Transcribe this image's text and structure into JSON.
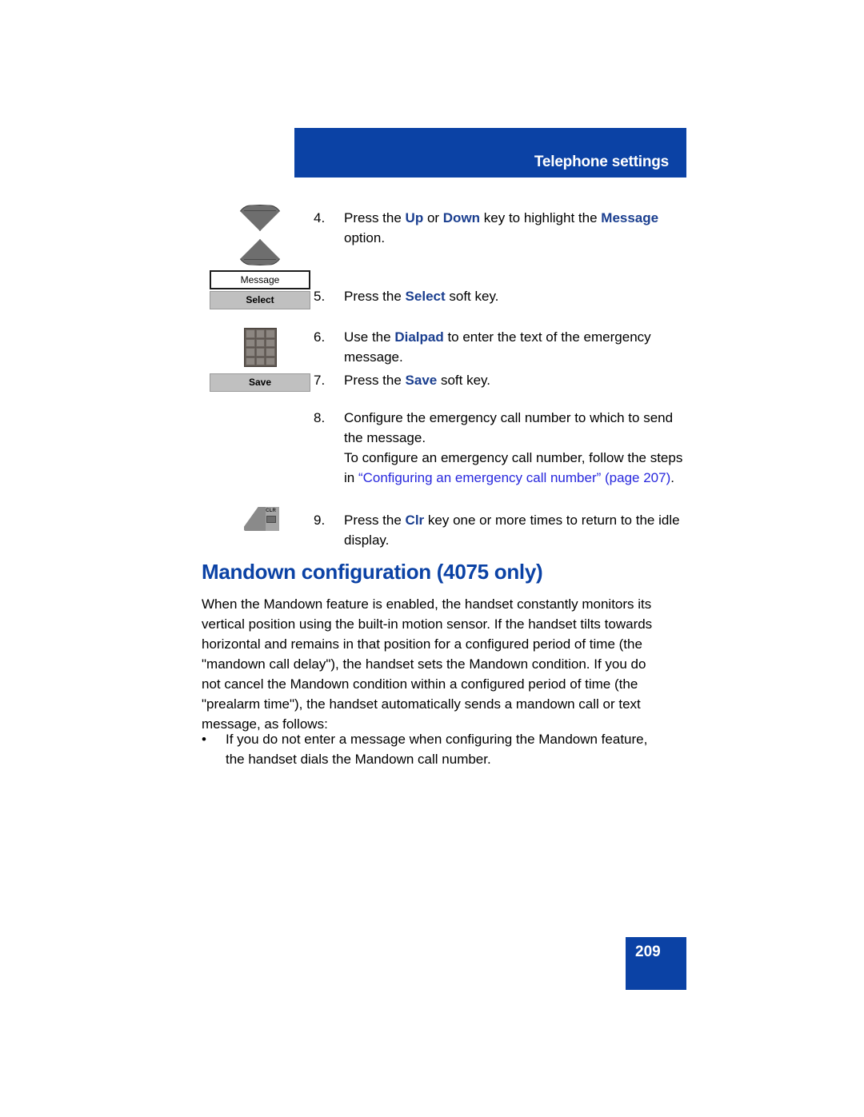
{
  "header": {
    "title": "Telephone settings",
    "banner_color": "#0B42A5"
  },
  "steps": [
    {
      "number": "4.",
      "segments": [
        {
          "text": "Press the ",
          "style": "normal"
        },
        {
          "text": "Up",
          "style": "keyword"
        },
        {
          "text": " or ",
          "style": "normal"
        },
        {
          "text": "Down",
          "style": "keyword"
        },
        {
          "text": " key to highlight the ",
          "style": "normal"
        },
        {
          "text": "Message",
          "style": "keyword"
        },
        {
          "text": " option.",
          "style": "normal"
        }
      ]
    },
    {
      "number": "5.",
      "segments": [
        {
          "text": "Press the ",
          "style": "normal"
        },
        {
          "text": "Select",
          "style": "keyword"
        },
        {
          "text": " soft key.",
          "style": "normal"
        }
      ]
    },
    {
      "number": "6.",
      "segments": [
        {
          "text": "Use the ",
          "style": "normal"
        },
        {
          "text": "Dialpad",
          "style": "keyword"
        },
        {
          "text": " to enter the text of the emergency message.",
          "style": "normal"
        }
      ]
    },
    {
      "number": "7.",
      "segments": [
        {
          "text": "Press the ",
          "style": "normal"
        },
        {
          "text": "Save",
          "style": "keyword"
        },
        {
          "text": " soft key.",
          "style": "normal"
        }
      ]
    },
    {
      "number": "8.",
      "segments": [
        {
          "text": "Configure the emergency call number to which to send the message.",
          "style": "normal"
        },
        {
          "text": "\nTo configure an emergency call number, follow the steps in ",
          "style": "normal"
        },
        {
          "text": "“Configuring an emergency call number” (page 207)",
          "style": "xref"
        },
        {
          "text": ".",
          "style": "normal"
        }
      ]
    },
    {
      "number": "9.",
      "segments": [
        {
          "text": "Press the ",
          "style": "normal"
        },
        {
          "text": "Clr",
          "style": "keyword"
        },
        {
          "text": " key one or more times to return to the idle display.",
          "style": "normal"
        }
      ]
    }
  ],
  "artwork": {
    "nav_key": "up-down-navigation-key",
    "message_box_label": "Message",
    "select_softkey_label": "Select",
    "dialpad": "dialpad-keys",
    "save_softkey_label": "Save",
    "clr_key_label": "CLR"
  },
  "section": {
    "heading": "Mandown configuration (4075 only)",
    "heading_color": "#0B42A5",
    "paragraph": "When the Mandown feature is enabled, the handset constantly monitors its vertical position using the built-in motion sensor. If the handset tilts towards horizontal and remains in that position for a configured period of time (the \"mandown call delay\"), the handset sets the Mandown condition. If you do not cancel the Mandown condition within a configured period of time (the \"prealarm time\"), the handset automatically sends a mandown call or text message, as follows:",
    "bullets": [
      {
        "marker": "•",
        "text": "If you do not enter a message when configuring the Mandown feature, the handset dials the Mandown call number."
      }
    ]
  },
  "footer": {
    "page_number": "209",
    "block_color": "#0B42A5"
  },
  "colors": {
    "keyword_blue": "#1A3E8F",
    "link_blue": "#2727DD",
    "brand_blue": "#0B42A5",
    "softkey_gray": "#C0C0C0"
  }
}
